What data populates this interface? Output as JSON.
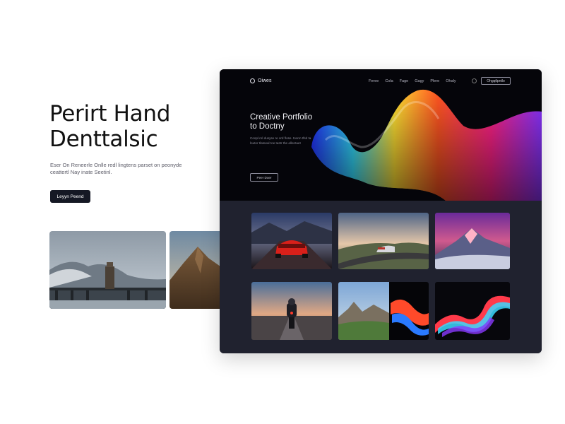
{
  "hero": {
    "title_line1": "Perirt Hand",
    "title_line2": "Denttalsic",
    "description": "Eser On Reneerle Onlle redl lingtens parset on peonyde ceattertl Nay inate Seetinl.",
    "button_label": "Leyyn Peend"
  },
  "left_gallery": [
    {
      "icon": "mountain-bridge-tower-photo"
    },
    {
      "icon": "mountain-peak-photo"
    }
  ],
  "mockup": {
    "logo_text": "Oiwes",
    "nav": [
      "Feree",
      "Cola",
      "Fage",
      "Gagy",
      "Plere",
      "Ohaly"
    ],
    "cta_label": "Ohgqtlpntlo",
    "title_line1": "Creative Portfolio",
    "title_line2": "to Doctny",
    "description": "Coopl rel dusyse re ord flose. toonn tfsd ta loutor tlatoeal toe tastr the allentaet",
    "button_label": "Peer Doer",
    "accent_gradient": [
      "#2233ff",
      "#33ddff",
      "#ffe033",
      "#ff5522",
      "#ff2288",
      "#8833ff"
    ],
    "gallery": [
      {
        "icon": "red-sports-car-photo"
      },
      {
        "icon": "car-on-road-photo"
      },
      {
        "icon": "pink-mountain-photo"
      },
      {
        "icon": "motorcycle-sunset-photo"
      },
      {
        "icon": "mountain-and-light-wave-photo"
      },
      {
        "icon": "neon-light-wave-photo"
      }
    ]
  }
}
